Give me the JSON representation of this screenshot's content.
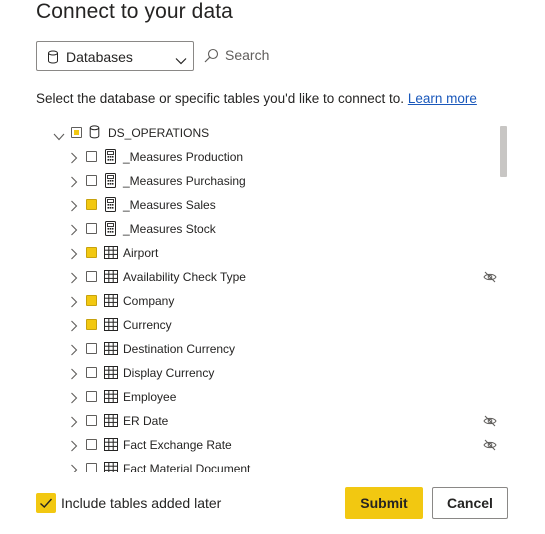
{
  "dialog": {
    "title": "Connect to your data",
    "source_dropdown": {
      "selected": "Databases"
    },
    "search": {
      "label": "Search"
    },
    "instructions": "Select the database or specific tables you'd like to connect to. ",
    "learn_more": "Learn more",
    "tree": {
      "root": {
        "label": "DS_OPERATIONS",
        "state": "partial",
        "expanded": true
      },
      "items": [
        {
          "label": "_Measures Production",
          "type": "measure",
          "checked": false,
          "hidden": false
        },
        {
          "label": "_Measures Purchasing",
          "type": "measure",
          "checked": false,
          "hidden": false
        },
        {
          "label": "_Measures Sales",
          "type": "measure",
          "checked": true,
          "hidden": false
        },
        {
          "label": "_Measures Stock",
          "type": "measure",
          "checked": false,
          "hidden": false
        },
        {
          "label": "Airport",
          "type": "table",
          "checked": true,
          "hidden": false
        },
        {
          "label": "Availability Check Type",
          "type": "table",
          "checked": false,
          "hidden": true
        },
        {
          "label": "Company",
          "type": "table",
          "checked": true,
          "hidden": false
        },
        {
          "label": "Currency",
          "type": "table",
          "checked": true,
          "hidden": false
        },
        {
          "label": "Destination Currency",
          "type": "table",
          "checked": false,
          "hidden": false
        },
        {
          "label": "Display Currency",
          "type": "table",
          "checked": false,
          "hidden": false
        },
        {
          "label": "Employee",
          "type": "table",
          "checked": false,
          "hidden": false
        },
        {
          "label": "ER Date",
          "type": "table",
          "checked": false,
          "hidden": true
        },
        {
          "label": "Fact Exchange Rate",
          "type": "table",
          "checked": false,
          "hidden": true
        },
        {
          "label": "Fact Material Document",
          "type": "table",
          "checked": false,
          "hidden": false
        }
      ]
    },
    "include_later": {
      "label": "Include tables added later",
      "checked": true
    },
    "buttons": {
      "submit": "Submit",
      "cancel": "Cancel"
    },
    "colors": {
      "accent": "#f2c811",
      "link": "#1a58bb",
      "text": "#252423"
    }
  }
}
